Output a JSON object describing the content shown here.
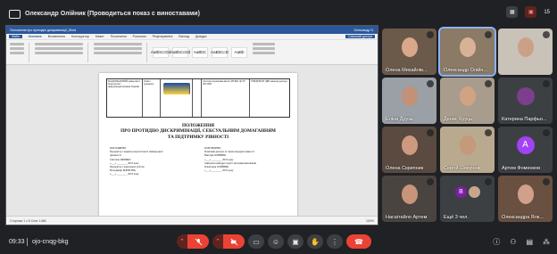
{
  "presenter": {
    "text": "Олександр Олійник (Проводиться показ с виноставами)"
  },
  "topbar": {
    "count": "15"
  },
  "word": {
    "title": "Положення про протидію дискримінації_Word",
    "user": "Олександр О.",
    "tabs": [
      "Файл",
      "Основне",
      "Вставлення",
      "Конструктор",
      "Макет",
      "Посилання",
      "Розсилки",
      "Рецензування",
      "Вигляд",
      "Довідка"
    ],
    "share": "Спільний доступ",
    "styles": [
      "AaBbCcDd",
      "AaBbCcDd",
      "AaBbC",
      "AaBbCcD",
      "AaBb"
    ],
    "status_left": "Сторінка 1 з 5   Слів: 1486",
    "status_right": "100%"
  },
  "doc": {
    "header_cells": [
      "НАЦІОНАЛЬНИЙ університет біоресурсів і природокористування України",
      "Освіта допомоги",
      "",
      "",
      "Система управління якістю НУБіП ДСТУ ISO 9001",
      "УВЕДЕНО В ДІЮ наказом ректора"
    ],
    "title_lines": [
      "ПОЛОЖЕННЯ",
      "ПРО ПРОТИДІЮ ДИСКРИМІНАЦІЇ, СЕКСУАЛЬНИМ ДОМАГАННЯМ",
      "ТА ПІДТРИМКУ РІВНОСТІ"
    ],
    "left_col": [
      "ПОГОДЖЕНО",
      "Проректор з науково-педагогічної і міжнародної діяльності",
      "Світлана ШИШКО",
      "«___» ________ 2023 року",
      "Проректор з навчальної роботи",
      "Володимир БОРИСЮК",
      "«___» ________ 2023 року"
    ],
    "right_col": [
      "РОЗРОБЛЕНО",
      "Помічник ректора зі справ ґендерної рівності",
      "Вікторія ОЛІЙНИК",
      "«___» ________ 2023 року",
      "Завідувач кафедри теорії і методики виховання",
      "Олександр ОЛІЙНИК",
      "«___» ________ 2023 року"
    ]
  },
  "participants": [
    {
      "name": "Олена Михайлів...",
      "kind": "video",
      "bg": "#6b5a4a",
      "face": "#d9a78a"
    },
    {
      "name": "Олександр Олійн...",
      "kind": "video",
      "bg": "#8a7a66",
      "face": "#d8b296",
      "speaking": true
    },
    {
      "name": "",
      "kind": "video",
      "bg": "#c9c2b8",
      "face": "#caa187"
    },
    {
      "name": "Еліна Друзь",
      "kind": "video",
      "bg": "#9aa0a6",
      "face": "#c39078"
    },
    {
      "name": "Денис Круць",
      "kind": "video",
      "bg": "#a89c8c",
      "face": "#d1a385"
    },
    {
      "name": "Катерина Парфьо...",
      "kind": "avatar",
      "bg": "#3c4043",
      "avatar_color": "#7b3f8c",
      "initial": ""
    },
    {
      "name": "Олена Скрипник",
      "kind": "video",
      "bg": "#5a4a40",
      "face": "#cd9a80"
    },
    {
      "name": "Сергій Шекунов",
      "kind": "video",
      "bg": "#b9a98f",
      "face": "#c59a7c"
    },
    {
      "name": "Артем Фоменков",
      "kind": "avatar",
      "bg": "#3c4043",
      "avatar_color": "#a142f4",
      "initial": "А"
    },
    {
      "name": "Насаітайло Артем",
      "kind": "video",
      "bg": "#4a4440",
      "face": "#c8947a"
    },
    {
      "name": "Ещё 3 чел.",
      "kind": "group",
      "bg": "#3c4043",
      "avatar_color": "#7b1fa2",
      "initial": "В"
    },
    {
      "name": "Олександра Ялк...",
      "kind": "video",
      "bg": "#6a5040",
      "face": "#d0a08a"
    }
  ],
  "bottom": {
    "time": "09:33",
    "meeting_code": "ojo-cnqg-bkg"
  }
}
